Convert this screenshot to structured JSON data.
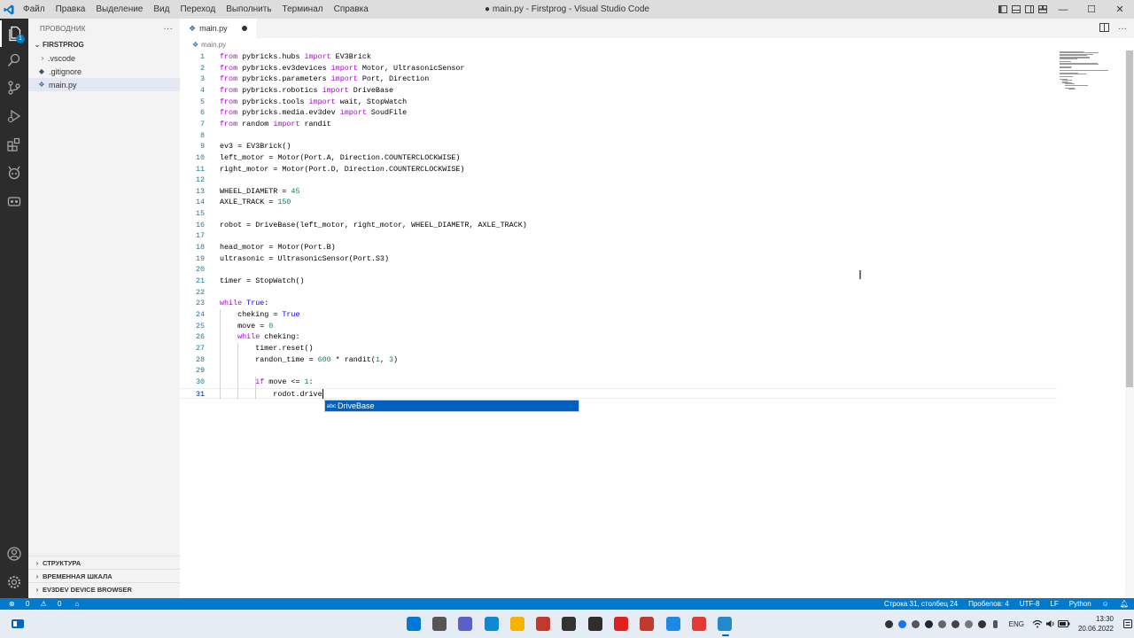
{
  "window": {
    "title": "● main.py - Firstprog - Visual Studio Code",
    "menu": [
      "Файл",
      "Правка",
      "Выделение",
      "Вид",
      "Переход",
      "Выполнить",
      "Терминал",
      "Справка"
    ],
    "controls": {
      "minimize": "—",
      "maximize": "☐",
      "close": "✕"
    }
  },
  "activity_bar": {
    "items": [
      "explorer-icon",
      "search-icon",
      "source-control-icon",
      "run-debug-icon",
      "extensions-icon",
      "ev3dev-icon",
      "remote-icon"
    ],
    "badge": "1",
    "bottom": [
      "account-icon",
      "gear-icon"
    ]
  },
  "sidebar": {
    "header": "ПРОВОДНИК",
    "more": "···",
    "folder": "FIRSTPROG",
    "items": [
      {
        "label": ".vscode",
        "type": "folder"
      },
      {
        "label": ".gitignore",
        "type": "file"
      },
      {
        "label": "main.py",
        "type": "python"
      }
    ],
    "sections": [
      "СТРУКТУРА",
      "ВРЕМЕННАЯ ШКАЛА",
      "EV3DEV DEVICE BROWSER"
    ]
  },
  "tab": {
    "label": "main.py"
  },
  "breadcrumb": "main.py",
  "code_lines": [
    {
      "n": "1",
      "t": "from pybricks.hubs import EV3Brick"
    },
    {
      "n": "2",
      "t": "from pybricks.ev3devices import Motor, UltrasonicSensor"
    },
    {
      "n": "3",
      "t": "from pybricks.parameters import Port, Direction"
    },
    {
      "n": "4",
      "t": "from pybricks.robotics import DriveBase"
    },
    {
      "n": "5",
      "t": "from pybricks.tools import wait, StopWatch"
    },
    {
      "n": "6",
      "t": "from pybricks.media.ev3dev import SoudFile"
    },
    {
      "n": "7",
      "t": "from random import randit"
    },
    {
      "n": "8",
      "t": ""
    },
    {
      "n": "9",
      "t": "ev3 = EV3Brick()"
    },
    {
      "n": "10",
      "t": "left_motor = Motor(Port.A, Direction.COUNTERCLOCKWISE)"
    },
    {
      "n": "11",
      "t": "right_motor = Motor(Port.D, Direction.COUNTERCLOCKWISE)"
    },
    {
      "n": "12",
      "t": ""
    },
    {
      "n": "13",
      "t": "WHEEL_DIAMETR = 45"
    },
    {
      "n": "14",
      "t": "AXLE_TRACK = 150"
    },
    {
      "n": "15",
      "t": ""
    },
    {
      "n": "16",
      "t": "robot = DriveBase(left_motor, right_motor, WHEEL_DIAMETR, AXLE_TRACK)"
    },
    {
      "n": "17",
      "t": ""
    },
    {
      "n": "18",
      "t": "head_motor = Motor(Port.B)"
    },
    {
      "n": "19",
      "t": "ultrasonic = UltrasonicSensor(Port.S3)"
    },
    {
      "n": "20",
      "t": ""
    },
    {
      "n": "21",
      "t": "timer = StopWatch()"
    },
    {
      "n": "22",
      "t": ""
    },
    {
      "n": "23",
      "t": "while True:"
    },
    {
      "n": "24",
      "t": "    cheking = True"
    },
    {
      "n": "25",
      "t": "    move = 0"
    },
    {
      "n": "26",
      "t": "    while cheking:"
    },
    {
      "n": "27",
      "t": "        timer.reset()"
    },
    {
      "n": "28",
      "t": "        randon_time = 600 * randit(1, 3)"
    },
    {
      "n": "29",
      "t": ""
    },
    {
      "n": "30",
      "t": "        if move <= 1:"
    },
    {
      "n": "31",
      "t": "            rodot.drive"
    }
  ],
  "suggestion": {
    "kind": "abc",
    "label": "DriveBase"
  },
  "statusbar": {
    "errors": "0",
    "warnings": "0",
    "position": "Строка 31, столбец 24",
    "spaces": "Пробелов: 4",
    "encoding": "UTF-8",
    "eol": "LF",
    "language": "Python"
  },
  "taskbar": {
    "apps": [
      {
        "name": "start-icon",
        "color": "#0078d4"
      },
      {
        "name": "task-view-icon",
        "color": "#555555"
      },
      {
        "name": "teams-chat-icon",
        "color": "#5b5fc7"
      },
      {
        "name": "edge-icon",
        "color": "#0c88d4"
      },
      {
        "name": "file-explorer-icon",
        "color": "#f4b400"
      },
      {
        "name": "media-app-icon",
        "color": "#c0392b"
      },
      {
        "name": "obs-icon",
        "color": "#333333"
      },
      {
        "name": "terminal-icon",
        "color": "#2d2d2d"
      },
      {
        "name": "acrobat-icon",
        "color": "#e02020"
      },
      {
        "name": "snipping-tool-icon",
        "color": "#c0392b"
      },
      {
        "name": "app-blue-icon",
        "color": "#1e88e5"
      },
      {
        "name": "anydesk-icon",
        "color": "#e53935"
      },
      {
        "name": "vscode-taskbar-icon",
        "color": "#2489ca"
      }
    ],
    "language": "ENG",
    "time": "13:30",
    "date": "20.06.2022"
  }
}
